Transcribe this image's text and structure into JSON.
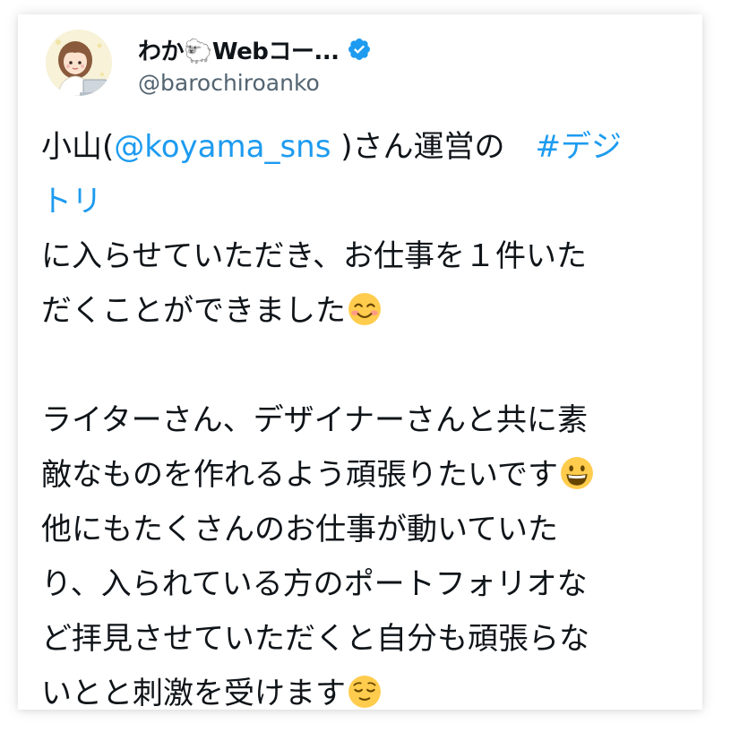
{
  "author": {
    "name": "わか🐑Webコー...",
    "handle": "@barochiroanko",
    "verified": true
  },
  "tweet": {
    "line1": {
      "pre": "小山(",
      "mention": "@koyama_sns",
      "mid": " )さん運営の　",
      "hashtag": "#デジ"
    },
    "line2": {
      "hashtag": "トリ"
    },
    "line3": "に入らせていただき、お仕事を１件いた",
    "line4": {
      "text": "だくことができました",
      "emoji": "smiling-face-emoji"
    },
    "line5": "ライターさん、デザイナーさんと共に素",
    "line6": {
      "text": "敵なものを作れるよう頑張りたいです",
      "emoji": "grinning-face-emoji"
    },
    "line7": "他にもたくさんのお仕事が動いていた",
    "line8": "り、入られている方のポートフォリオな",
    "line9": "ど拝見させていただくと自分も頑張らな",
    "line10": {
      "text": "いとと刺激を受けます",
      "emoji": "relieved-face-emoji"
    }
  },
  "colors": {
    "text": "#0f1419",
    "secondary": "#536471",
    "link": "#1d9bf0",
    "verified": "#1d9bf0"
  }
}
